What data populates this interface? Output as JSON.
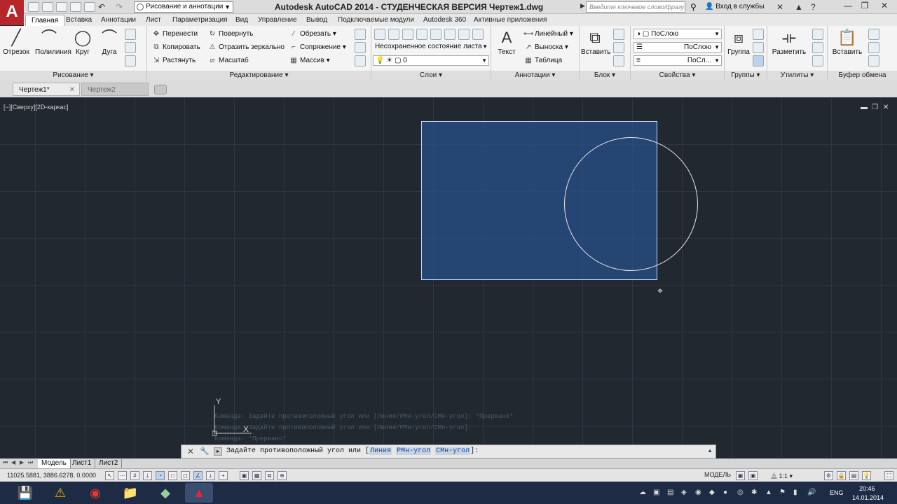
{
  "app": {
    "logo": "A",
    "title": "Autodesk AutoCAD 2014 - СТУДЕНЧЕСКАЯ ВЕРСИЯ    Чертеж1.dwg",
    "workspace": "Рисование и аннотации",
    "search_placeholder": "Введите ключевое слово/фразу",
    "signin": "Вход в службы"
  },
  "ribbon_tabs": [
    "Главная",
    "Вставка",
    "Аннотации",
    "Лист",
    "Параметризация",
    "Вид",
    "Управление",
    "Вывод",
    "Подключаемые модули",
    "Autodesk 360",
    "Активные приложения"
  ],
  "panels": {
    "draw": {
      "title": "Рисование",
      "line": "Отрезок",
      "polyline": "Полилиния",
      "circle": "Круг",
      "arc": "Дуга"
    },
    "modify": {
      "title": "Редактирование",
      "move": "Перенести",
      "rotate": "Повернуть",
      "trim": "Обрезать",
      "copy": "Копировать",
      "mirror": "Отразить зеркально",
      "fillet": "Сопряжение",
      "stretch": "Растянуть",
      "scale": "Масштаб",
      "array": "Массив"
    },
    "layers": {
      "title": "Слои",
      "state": "Несохраненное состояние листа",
      "current": "0"
    },
    "annotation": {
      "title": "Аннотации",
      "text": "Текст",
      "linear": "Линейный",
      "leader": "Выноска",
      "table": "Таблица"
    },
    "block": {
      "title": "Блок",
      "insert": "Вставить"
    },
    "properties": {
      "title": "Свойства",
      "color": "ПоСлою",
      "linetype": "ПоСлою",
      "lineweight": "ПоСл..."
    },
    "groups": {
      "title": "Группы",
      "group": "Группа"
    },
    "utilities": {
      "title": "Утилиты",
      "measure": "Разметить"
    },
    "clipboard": {
      "title": "Буфер обмена",
      "paste": "Вставить"
    }
  },
  "file_tabs": [
    "Чертеж1*",
    "Чертеж2"
  ],
  "viewport": {
    "label": "[−][Сверху][2D-каркас]",
    "ucs_y": "Y",
    "ucs_x": "X"
  },
  "command_history": [
    "Команда: Задайте противоположный угол или [Линия/РМн-угол/СМн-угол]: *Прервано*",
    "Команда: Задайте противоположный угол или [Линия/РМн-угол/СМн-угол]:",
    "Команда: *Прервано*"
  ],
  "command_prompt": {
    "prefix": "Задайте противоположный угол или [",
    "opt1": "Линия",
    "opt2": "РМн-угол",
    "opt3": "СМн-угол",
    "suffix": "]:"
  },
  "layout_tabs": [
    "Модель",
    "Лист1",
    "Лист2"
  ],
  "status": {
    "coords": "11025.5881, 3886.6278, 0.0000",
    "model": "МОДЕЛЬ",
    "scale": "1:1"
  },
  "taskbar": {
    "lang": "ENG",
    "time": "20:46",
    "date": "14.01.2014"
  }
}
